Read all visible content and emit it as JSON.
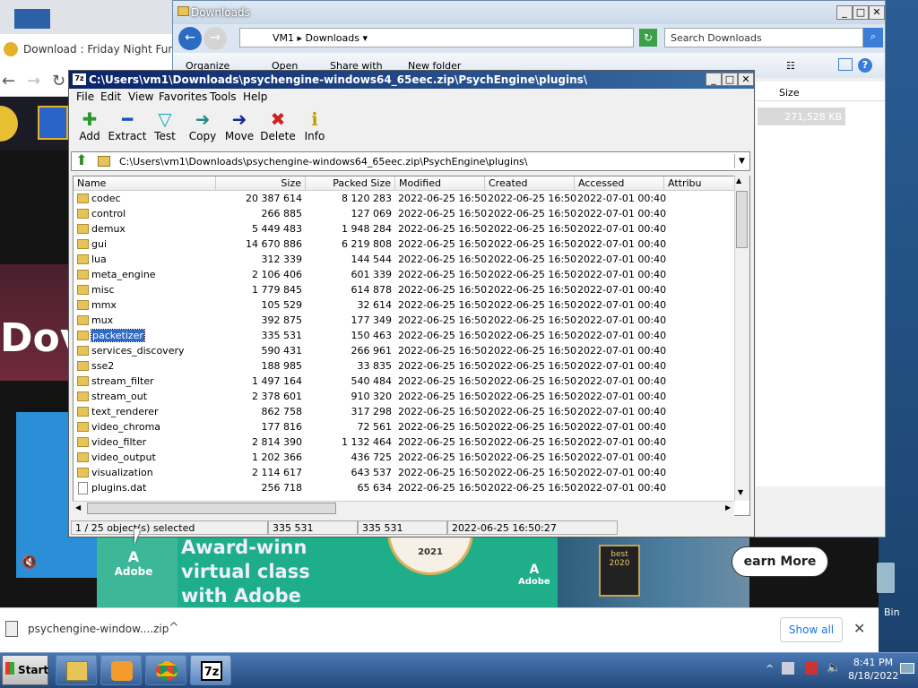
{
  "chrome": {
    "tab_title": "Download : Friday Night Funkin' -",
    "page_big_text": "Dov",
    "download_filename": "psychengine-window....zip",
    "show_all_label": "Show all"
  },
  "ad": {
    "line1": "Award-winn",
    "line2": "virtual class",
    "line3": "with Adobe",
    "logo_text": "Adobe",
    "badge_year": "2021",
    "badge2_text": "best 2020",
    "learn_more": "earn More"
  },
  "explorer": {
    "title": "Downloads",
    "breadcrumb": [
      "VM1",
      "Downloads"
    ],
    "search_placeholder": "Search Downloads",
    "cmd": [
      "Organize",
      "Open",
      "Share with",
      "New folder"
    ],
    "size_header": "Size",
    "selected_size": "271,528 KB"
  },
  "desktop": {
    "recycle_bin_label": "Bin"
  },
  "zip": {
    "title": "C:\\Users\\vm1\\Downloads\\psychengine-windows64_65eec.zip\\PsychEngine\\plugins\\",
    "menu": [
      "File",
      "Edit",
      "View",
      "Favorites",
      "Tools",
      "Help"
    ],
    "toolbar": [
      {
        "label": "Add",
        "icon": "add-icon"
      },
      {
        "label": "Extract",
        "icon": "extract-icon"
      },
      {
        "label": "Test",
        "icon": "test-icon"
      },
      {
        "label": "Copy",
        "icon": "copy-icon"
      },
      {
        "label": "Move",
        "icon": "move-icon"
      },
      {
        "label": "Delete",
        "icon": "delete-icon"
      },
      {
        "label": "Info",
        "icon": "info-icon"
      }
    ],
    "path": "C:\\Users\\vm1\\Downloads\\psychengine-windows64_65eec.zip\\PsychEngine\\plugins\\",
    "columns": [
      "Name",
      "Size",
      "Packed Size",
      "Modified",
      "Created",
      "Accessed",
      "Attribu"
    ],
    "rows": [
      {
        "name": "codec",
        "size": "20 387 614",
        "packed": "8 120 283",
        "modified": "2022-06-25 16:50",
        "created": "2022-06-25 16:50",
        "accessed": "2022-07-01 00:40",
        "type": "folder"
      },
      {
        "name": "control",
        "size": "266 885",
        "packed": "127 069",
        "modified": "2022-06-25 16:50",
        "created": "2022-06-25 16:50",
        "accessed": "2022-07-01 00:40",
        "type": "folder"
      },
      {
        "name": "demux",
        "size": "5 449 483",
        "packed": "1 948 284",
        "modified": "2022-06-25 16:50",
        "created": "2022-06-25 16:50",
        "accessed": "2022-07-01 00:40",
        "type": "folder"
      },
      {
        "name": "gui",
        "size": "14 670 886",
        "packed": "6 219 808",
        "modified": "2022-06-25 16:50",
        "created": "2022-06-25 16:50",
        "accessed": "2022-07-01 00:40",
        "type": "folder"
      },
      {
        "name": "lua",
        "size": "312 339",
        "packed": "144 544",
        "modified": "2022-06-25 16:50",
        "created": "2022-06-25 16:50",
        "accessed": "2022-07-01 00:40",
        "type": "folder"
      },
      {
        "name": "meta_engine",
        "size": "2 106 406",
        "packed": "601 339",
        "modified": "2022-06-25 16:50",
        "created": "2022-06-25 16:50",
        "accessed": "2022-07-01 00:40",
        "type": "folder"
      },
      {
        "name": "misc",
        "size": "1 779 845",
        "packed": "614 878",
        "modified": "2022-06-25 16:50",
        "created": "2022-06-25 16:50",
        "accessed": "2022-07-01 00:40",
        "type": "folder"
      },
      {
        "name": "mmx",
        "size": "105 529",
        "packed": "32 614",
        "modified": "2022-06-25 16:50",
        "created": "2022-06-25 16:50",
        "accessed": "2022-07-01 00:40",
        "type": "folder"
      },
      {
        "name": "mux",
        "size": "392 875",
        "packed": "177 349",
        "modified": "2022-06-25 16:50",
        "created": "2022-06-25 16:50",
        "accessed": "2022-07-01 00:40",
        "type": "folder"
      },
      {
        "name": "packetizer",
        "size": "335 531",
        "packed": "150 463",
        "modified": "2022-06-25 16:50",
        "created": "2022-06-25 16:50",
        "accessed": "2022-07-01 00:40",
        "type": "folder",
        "selected": true
      },
      {
        "name": "services_discovery",
        "size": "590 431",
        "packed": "266 961",
        "modified": "2022-06-25 16:50",
        "created": "2022-06-25 16:50",
        "accessed": "2022-07-01 00:40",
        "type": "folder"
      },
      {
        "name": "sse2",
        "size": "188 985",
        "packed": "33 835",
        "modified": "2022-06-25 16:50",
        "created": "2022-06-25 16:50",
        "accessed": "2022-07-01 00:40",
        "type": "folder"
      },
      {
        "name": "stream_filter",
        "size": "1 497 164",
        "packed": "540 484",
        "modified": "2022-06-25 16:50",
        "created": "2022-06-25 16:50",
        "accessed": "2022-07-01 00:40",
        "type": "folder"
      },
      {
        "name": "stream_out",
        "size": "2 378 601",
        "packed": "910 320",
        "modified": "2022-06-25 16:50",
        "created": "2022-06-25 16:50",
        "accessed": "2022-07-01 00:40",
        "type": "folder"
      },
      {
        "name": "text_renderer",
        "size": "862 758",
        "packed": "317 298",
        "modified": "2022-06-25 16:50",
        "created": "2022-06-25 16:50",
        "accessed": "2022-07-01 00:40",
        "type": "folder"
      },
      {
        "name": "video_chroma",
        "size": "177 816",
        "packed": "72 561",
        "modified": "2022-06-25 16:50",
        "created": "2022-06-25 16:50",
        "accessed": "2022-07-01 00:40",
        "type": "folder"
      },
      {
        "name": "video_filter",
        "size": "2 814 390",
        "packed": "1 132 464",
        "modified": "2022-06-25 16:50",
        "created": "2022-06-25 16:50",
        "accessed": "2022-07-01 00:40",
        "type": "folder"
      },
      {
        "name": "video_output",
        "size": "1 202 366",
        "packed": "436 725",
        "modified": "2022-06-25 16:50",
        "created": "2022-06-25 16:50",
        "accessed": "2022-07-01 00:40",
        "type": "folder"
      },
      {
        "name": "visualization",
        "size": "2 114 617",
        "packed": "643 537",
        "modified": "2022-06-25 16:50",
        "created": "2022-06-25 16:50",
        "accessed": "2022-07-01 00:40",
        "type": "folder"
      },
      {
        "name": "plugins.dat",
        "size": "256 718",
        "packed": "65 634",
        "modified": "2022-06-25 16:50",
        "created": "2022-06-25 16:50",
        "accessed": "2022-07-01 00:40",
        "type": "file"
      }
    ],
    "status": [
      "1 / 25 object(s) selected",
      "335 531",
      "335 531",
      "2022-06-25 16:50:27"
    ]
  },
  "taskbar": {
    "start_label": "Start",
    "time": "8:41 PM",
    "date": "8/18/2022"
  },
  "colors": {
    "selection": "#316ac5",
    "zip_title_start": "#0a246a",
    "taskbar": "#22497c"
  }
}
